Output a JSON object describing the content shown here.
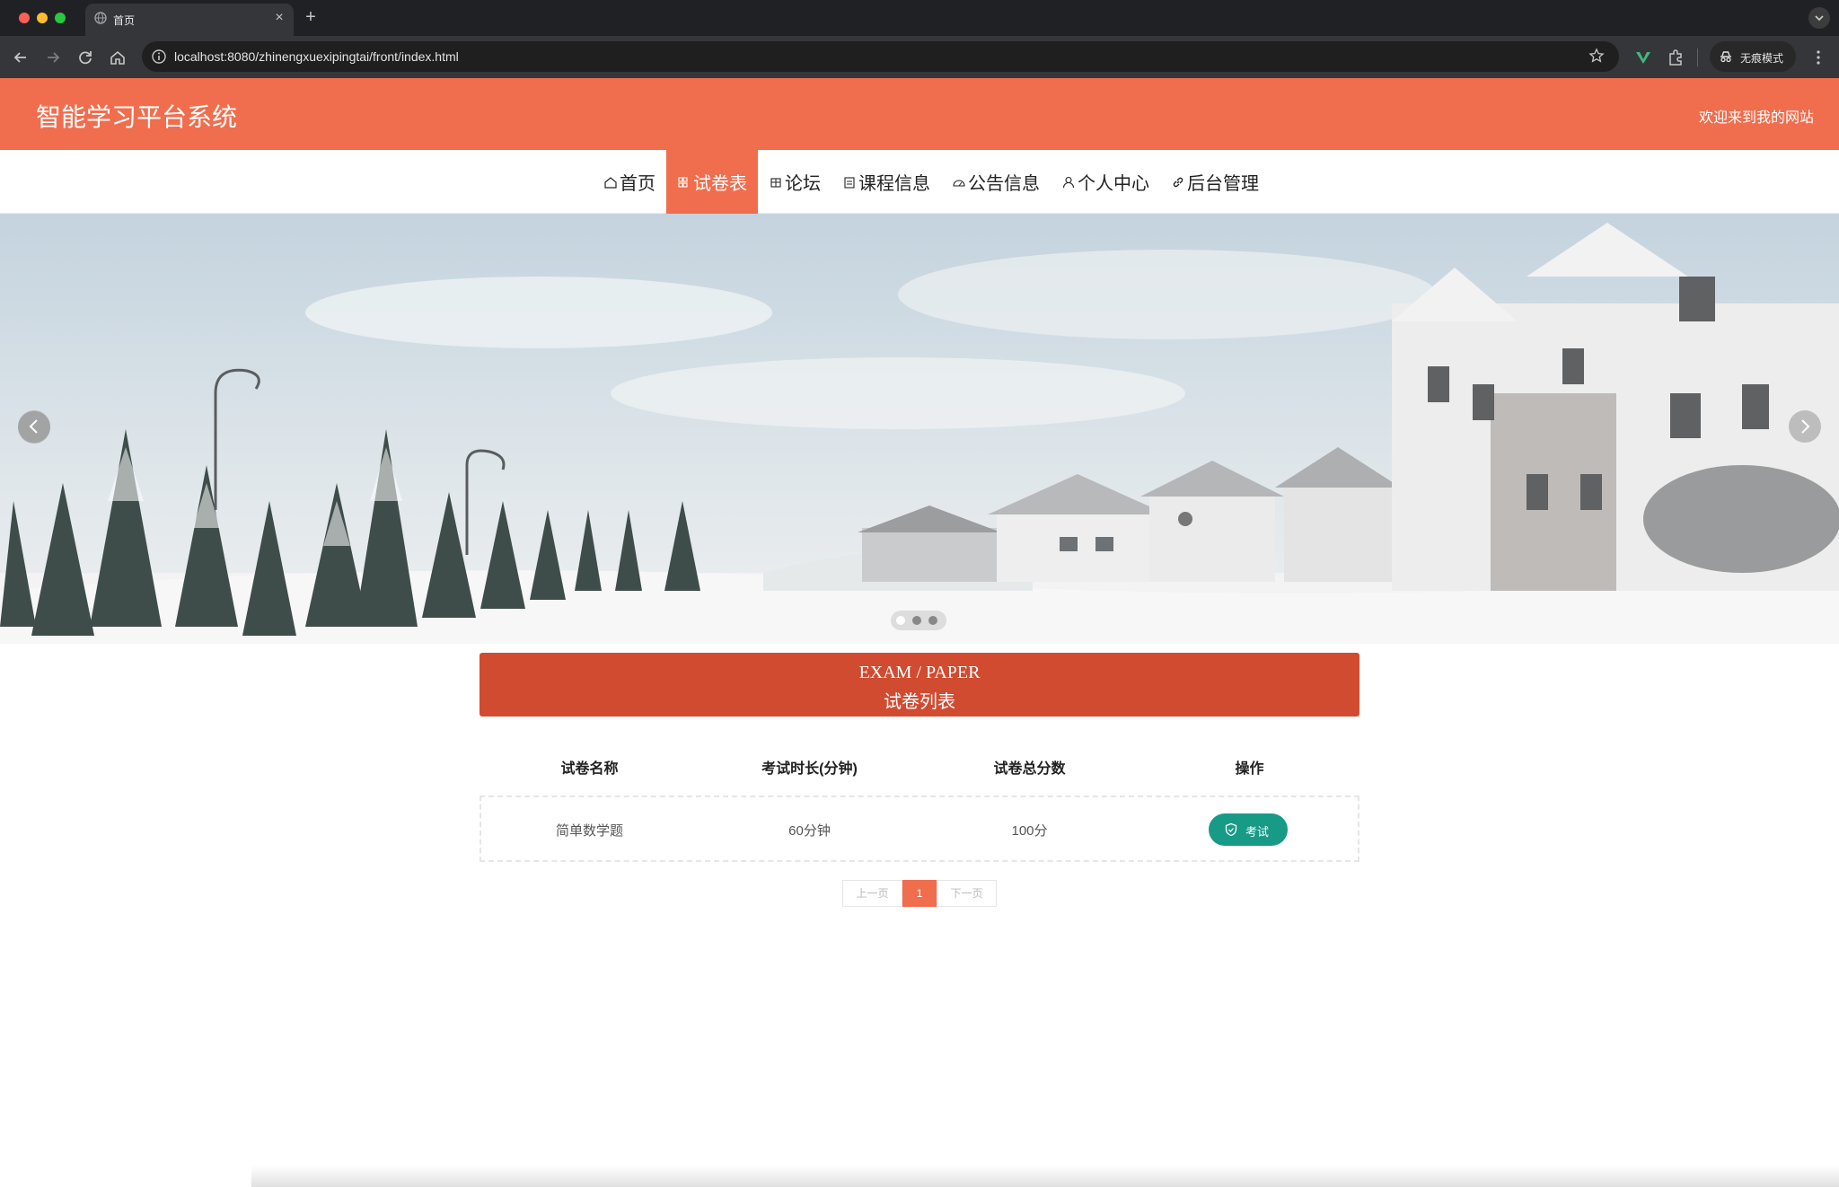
{
  "browser": {
    "tab_title": "首页",
    "url": "localhost:8080/zhinengxuexipingtai/front/index.html",
    "incognito_label": "无痕模式"
  },
  "site": {
    "title": "智能学习平台系统",
    "welcome": "欢迎来到我的网站",
    "accent_color": "#f06d4d"
  },
  "nav": {
    "items": [
      {
        "label": "首页",
        "icon": "home-icon"
      },
      {
        "label": "试卷表",
        "icon": "grid-icon",
        "active": true
      },
      {
        "label": "论坛",
        "icon": "forum-icon"
      },
      {
        "label": "课程信息",
        "icon": "course-icon"
      },
      {
        "label": "公告信息",
        "icon": "notice-icon"
      },
      {
        "label": "个人中心",
        "icon": "user-icon"
      },
      {
        "label": "后台管理",
        "icon": "link-icon"
      }
    ]
  },
  "banner": {
    "slides": 3,
    "active_slide": 1
  },
  "section": {
    "title_en": "EXAM / PAPER",
    "title_cn": "试卷列表"
  },
  "table": {
    "headers": [
      "试卷名称",
      "考试时长(分钟)",
      "试卷总分数",
      "操作"
    ],
    "rows": [
      {
        "name": "简单数学题",
        "duration": "60分钟",
        "score": "100分",
        "action": "考试"
      }
    ]
  },
  "pagination": {
    "prev": "上一页",
    "current": "1",
    "next": "下一页"
  }
}
